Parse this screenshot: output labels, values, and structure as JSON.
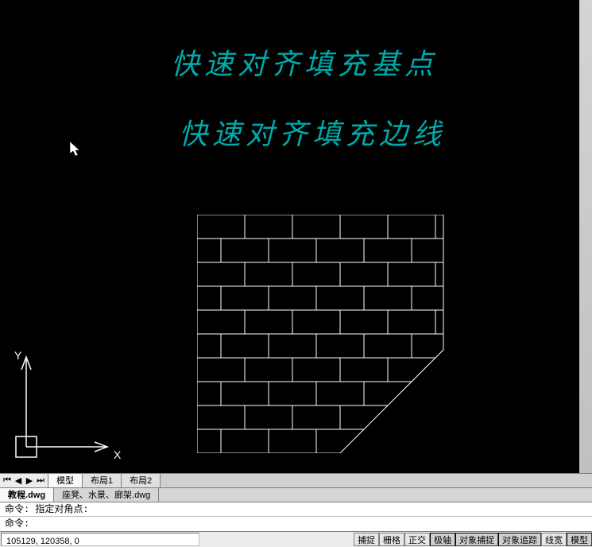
{
  "annotations": {
    "line1": "快速对齐填充基点",
    "line2": "快速对齐填充边线"
  },
  "ucs": {
    "y_label": "Y",
    "x_label": "X"
  },
  "layout_tabs": {
    "model": "模型",
    "layout1": "布局1",
    "layout2": "布局2"
  },
  "doc_tabs": {
    "active": "教程.dwg",
    "other": "座凳、水景、廊架.dwg"
  },
  "command": {
    "hist1": "命令: 指定对角点:",
    "prompt": "命令:"
  },
  "status": {
    "coords": "105129, 120358, 0",
    "toggles": {
      "snap": "捕捉",
      "grid": "栅格",
      "ortho": "正交",
      "polar": "极轴",
      "osnap": "对象捕捉",
      "otrack": "对象追踪",
      "lwt": "线宽",
      "model": "模型"
    }
  }
}
